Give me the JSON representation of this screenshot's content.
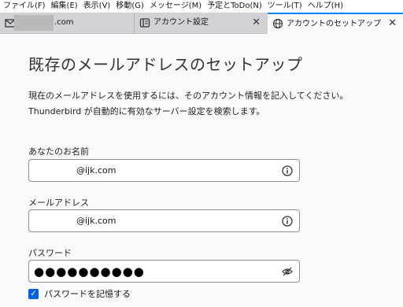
{
  "menubar": {
    "items": [
      "ファイル(F)",
      "編集(E)",
      "表示(V)",
      "移動(G)",
      "メッセージ(M)",
      "予定とToDo(N)",
      "ツール(T)",
      "ヘルプ(H)"
    ]
  },
  "tabs": [
    {
      "label": ".com",
      "icon": "mail-icon",
      "close": ""
    },
    {
      "label": "アカウント設定",
      "icon": "settings-page-icon",
      "close": "✕"
    },
    {
      "label": "アカウントのセットアップ",
      "icon": "globe-icon",
      "close": "✕",
      "active": true
    }
  ],
  "page": {
    "title": "既存のメールアドレスのセットアップ",
    "description_line1": "現在のメールアドレスを使用するには、そのアカウント情報を記入してください。",
    "description_line2": "Thunderbird が自動的に有効なサーバー設定を検索します。"
  },
  "form": {
    "name_label": "あなたのお名前",
    "name_value": "@ijk.com",
    "email_label": "メールアドレス",
    "email_value": "@ijk.com",
    "password_label": "パスワード",
    "password_masked": "●●●●●●●●●●",
    "remember_label": "パスワードを記憶する",
    "remember_checked": true
  },
  "colors": {
    "accent": "#0060df",
    "active_tab_border": "#0a84ff"
  }
}
